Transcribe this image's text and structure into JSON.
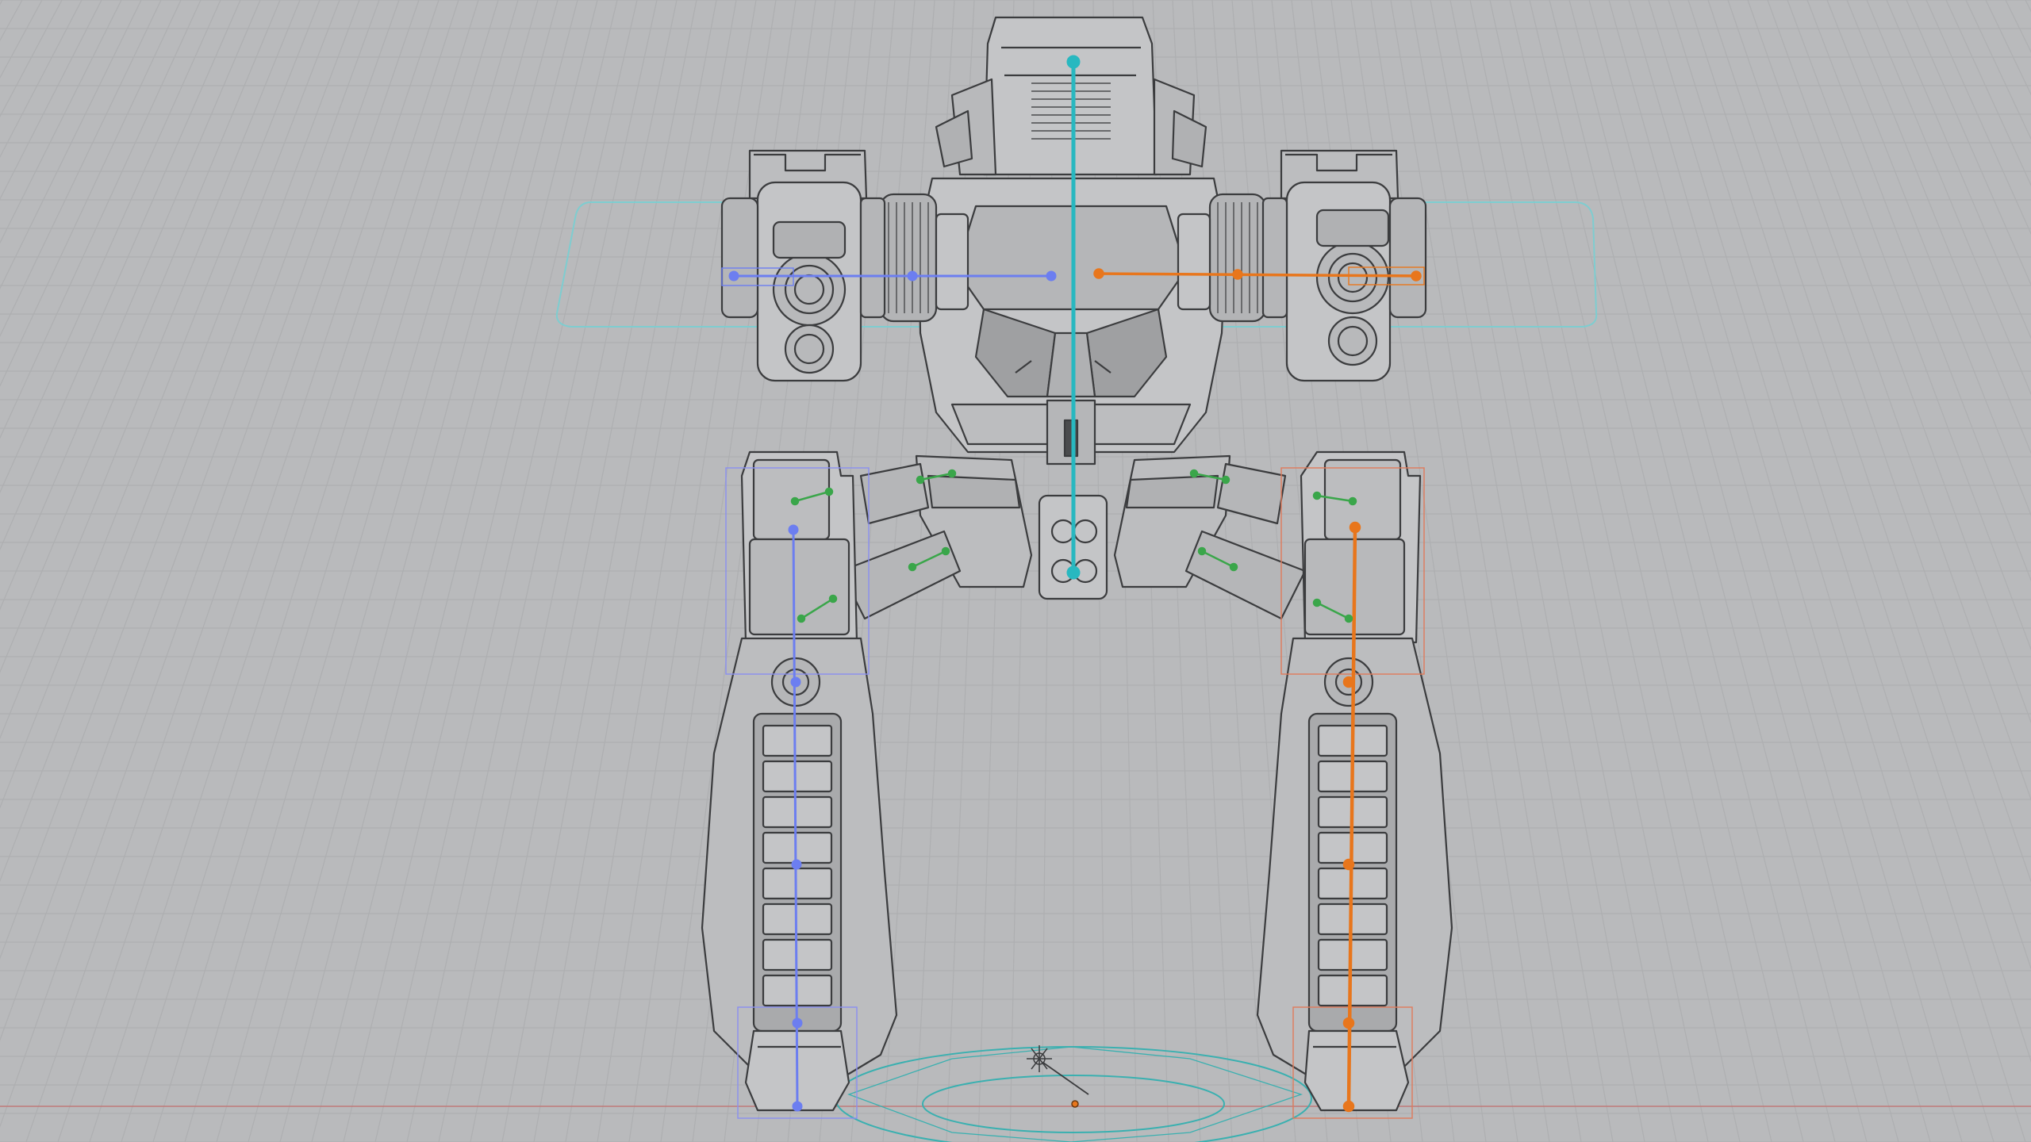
{
  "viewport": {
    "mode": "wireframe-overlay",
    "colors": {
      "background": "#b9babc",
      "grid_minor": "#aeafb1",
      "grid_major": "#a7a8aa",
      "ground_line": "#c07a7a",
      "mesh_fill": "#c4c5c7",
      "mesh_fill_dark": "#a9aaac",
      "mesh_wire": "#3b3c3e",
      "mesh_wire_light": "#6a6b6d",
      "spine_bone": "#28b8c0",
      "right_side_bones": "#6c7ef0",
      "left_side_bones": "#e8761c",
      "helper_bones": "#3aa64a",
      "root_control": "#3ab0b0",
      "plane_control": "#7ecdd0",
      "left_leg_box": "#e07a5a",
      "right_leg_box": "#8a8ff0"
    }
  },
  "objects": {
    "mesh": "mech-walker",
    "armature": "mech-rig",
    "origin": "world-origin-icon"
  }
}
